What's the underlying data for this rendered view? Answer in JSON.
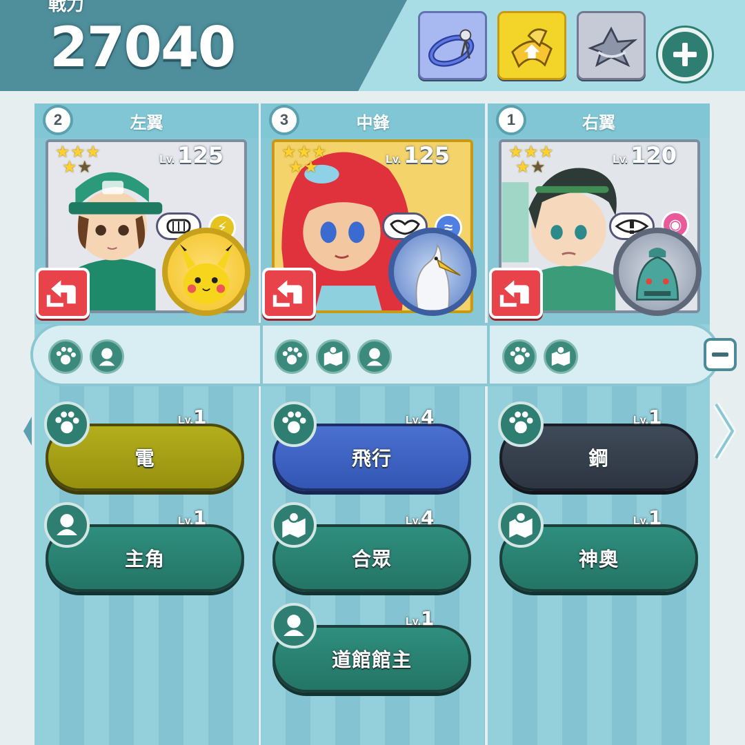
{
  "header": {
    "power_label": "戦力",
    "power_value": "27040",
    "items": [
      {
        "name": "ribbon-item-icon",
        "color": "#a8b8f0"
      },
      {
        "name": "yellow-scarf-item-icon",
        "color": "#f3d52a"
      },
      {
        "name": "steel-crest-item-icon",
        "color": "#c6cad6"
      }
    ]
  },
  "columns": [
    {
      "position_number": "2",
      "position_name": "左翼",
      "level_prefix": "Lv.",
      "level": "125",
      "rank": "5",
      "stars": 5,
      "filters": [
        "paw-icon",
        "trainer-icon"
      ],
      "pills": [
        {
          "label": "電",
          "lv_prefix": "Lv.",
          "lv": "1",
          "icon": "paw-icon",
          "color": "elec"
        },
        {
          "label": "主角",
          "lv_prefix": "Lv.",
          "lv": "1",
          "icon": "trainer-icon",
          "color": "green"
        }
      ]
    },
    {
      "position_number": "3",
      "position_name": "中鋒",
      "level_prefix": "Lv.",
      "level": "125",
      "rank": "3",
      "stars": 5,
      "filters": [
        "paw-icon",
        "map-icon",
        "trainer-icon"
      ],
      "pills": [
        {
          "label": "飛行",
          "lv_prefix": "Lv.",
          "lv": "4",
          "icon": "paw-icon",
          "color": "fly"
        },
        {
          "label": "合眾",
          "lv_prefix": "Lv.",
          "lv": "4",
          "icon": "map-icon",
          "color": "green"
        },
        {
          "label": "道館館主",
          "lv_prefix": "Lv.",
          "lv": "1",
          "icon": "trainer-icon",
          "color": "green"
        }
      ]
    },
    {
      "position_number": "1",
      "position_name": "右翼",
      "level_prefix": "Lv.",
      "level": "120",
      "rank": "5",
      "stars": 5,
      "filters": [
        "paw-icon",
        "map-icon"
      ],
      "pills": [
        {
          "label": "鋼",
          "lv_prefix": "Lv.",
          "lv": "1",
          "icon": "paw-icon",
          "color": "steel"
        },
        {
          "label": "神奧",
          "lv_prefix": "Lv.",
          "lv": "1",
          "icon": "map-icon",
          "color": "green"
        }
      ]
    }
  ]
}
